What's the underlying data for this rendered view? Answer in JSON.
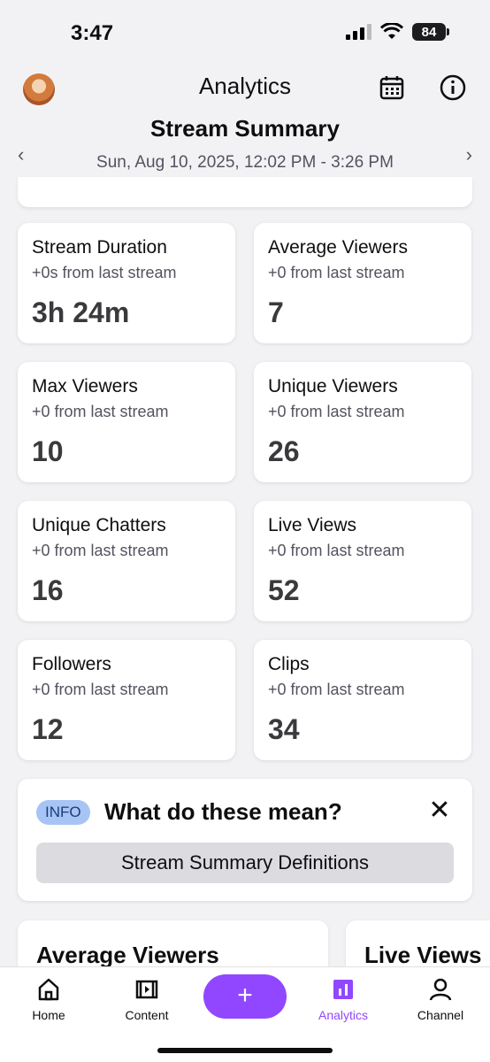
{
  "status_bar": {
    "time": "3:47",
    "battery": "84"
  },
  "header": {
    "title": "Analytics",
    "calendar_icon": "calendar-icon",
    "info_icon": "info-icon"
  },
  "summary": {
    "title": "Stream Summary",
    "date_range": "Sun, Aug 10, 2025, 12:02 PM - 3:26 PM"
  },
  "stats": [
    {
      "label": "Stream Duration",
      "delta": "+0s from last stream",
      "value": "3h 24m"
    },
    {
      "label": "Average Viewers",
      "delta": "+0 from last stream",
      "value": "7"
    },
    {
      "label": "Max Viewers",
      "delta": "+0 from last stream",
      "value": "10"
    },
    {
      "label": "Unique Viewers",
      "delta": "+0 from last stream",
      "value": "26"
    },
    {
      "label": "Unique Chatters",
      "delta": "+0 from last stream",
      "value": "16"
    },
    {
      "label": "Live Views",
      "delta": "+0 from last stream",
      "value": "52"
    },
    {
      "label": "Followers",
      "delta": "+0 from last stream",
      "value": "12"
    },
    {
      "label": "Clips",
      "delta": "+0 from last stream",
      "value": "34"
    }
  ],
  "info": {
    "badge": "INFO",
    "question": "What do these mean?",
    "button": "Stream Summary Definitions"
  },
  "charts": [
    {
      "title": "Average Viewers"
    },
    {
      "title": "Live Views"
    }
  ],
  "tabbar": {
    "home": "Home",
    "content": "Content",
    "add": "+",
    "analytics": "Analytics",
    "channel": "Channel"
  },
  "colors": {
    "accent": "#9147ff",
    "info_badge": "#a7c4f5"
  }
}
